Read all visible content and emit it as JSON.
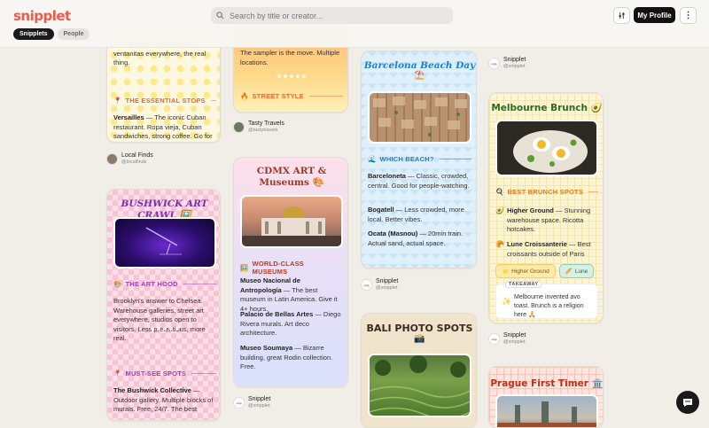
{
  "header": {
    "logo": "snipplet",
    "search_placeholder": "Search by title or creator...",
    "profile": "My Profile",
    "more": "⋮"
  },
  "tabs": [
    "Snipplets",
    "People"
  ],
  "c1": {
    "top_text": "murals. Benches in the park, ventanitas everywhere, the real thing.",
    "sec": "THE ESSENTIAL STOPS",
    "body_b": "Versailles",
    "body": " — The iconic Cuban restaurant. Ropa vieja, Cuban sandwiches, strong coffee. Go for"
  },
  "cap1": {
    "name": "Local Finds",
    "handle": "@localfinds"
  },
  "c2": {
    "title": "BUSHWICK ART CRAWL 🖼️",
    "sec1": "THE ART HOOD",
    "body1": "Brooklyn's answer to Chelsea. Warehouse galleries, street art everywhere, studios open to visitors. Less pretentious, more real.",
    "sec2": "MUST-SEE SPOTS",
    "body2_b": "The Bushwick Collective",
    "body2": " — Outdoor gallery. Multiple blocks of murals. Free, 24/7. The best"
  },
  "c3": {
    "top_text": "The sampler is the move. Multiple locations.",
    "sec": "STREET STYLE"
  },
  "cap3": {
    "name": "Tasty Travels",
    "handle": "@tastytravels"
  },
  "c4": {
    "title_l1": "CDMX ART &",
    "title_l2": "Museums 🎨",
    "sec": "WORLD-CLASS MUSEUMS",
    "items": [
      {
        "b": "Museo Nacional de Antropología",
        "t": " — The best museum in Latin America. Give it 4+ hours."
      },
      {
        "b": "Palacio de Bellas Artes",
        "t": " — Diego Rivera murals. Art deco architecture."
      },
      {
        "b": "Museo Soumaya",
        "t": " — Bizarre building, great Rodin collection. Free."
      }
    ]
  },
  "cap4": {
    "name": "Snipplet",
    "handle": "@snipplet"
  },
  "c5": {
    "title": "Barcelona Beach Day",
    "emoji": "⛱️",
    "sec": "WHICH BEACH?",
    "items": [
      {
        "b": "Barceloneta",
        "t": " — Classic, crowded, central. Good for people-watching."
      },
      {
        "b": "Bogatell",
        "t": " — Less crowded, more local. Better vibes."
      },
      {
        "b": "Ocata (Masnou)",
        "t": " — 20min train. Actual sand, actual space."
      }
    ]
  },
  "cap5": {
    "name": "Snipplet",
    "handle": "@snipplet"
  },
  "c6": {
    "title": "BALI PHOTO SPOTS",
    "emoji": "📸"
  },
  "cap6top": {
    "name": "Snipplet",
    "handle": "@snipplet"
  },
  "c7": {
    "title": "Melbourne Brunch 🥑",
    "sec": "BEST BRUNCH SPOTS",
    "items": [
      {
        "b": "Higher Ground",
        "t": " — Stunning warehouse space. Ricotta hotcakes."
      },
      {
        "b": "Lune Croissanterie",
        "t": " — Best croissants outside of Paris"
      }
    ],
    "chips": [
      "Higher Ground",
      "Lune"
    ],
    "takeaway_label": "TAKEAWAY",
    "takeaway": "Melbourne invented avo toast. Brunch is a religion here 🙏"
  },
  "cap7": {
    "name": "Snipplet",
    "handle": "@snipplet"
  },
  "c8": {
    "title": "Prague First Timer 🏛️"
  },
  "colors": {
    "brand": "#ef5a4a",
    "dark": "#1a1a1a"
  }
}
